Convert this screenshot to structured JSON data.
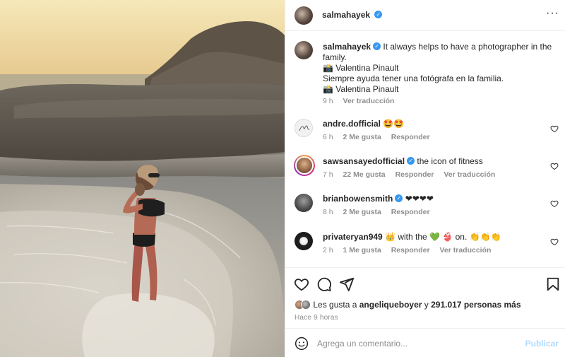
{
  "post": {
    "username": "salmahayek",
    "more_icon": "more-horizontal-icon",
    "caption": {
      "text": "It always helps to have a photographer in the family.",
      "credit": "📸 Valentina Pinault",
      "text_es": "Siempre ayuda tener una fotógrafa en la familia.",
      "credit_es": "📸 Valentina Pinault",
      "time": "9 h",
      "translate_label": "Ver traducción"
    }
  },
  "comments": [
    {
      "username": "andre.dofficial",
      "verified": false,
      "text": "🤩🤩",
      "time": "6 h",
      "likes": "2 Me gusta",
      "reply": "Responder",
      "translate": ""
    },
    {
      "username": "sawsansayedofficial",
      "verified": true,
      "text": "the icon of fitness",
      "time": "7 h",
      "likes": "22 Me gusta",
      "reply": "Responder",
      "translate": "Ver traducción"
    },
    {
      "username": "brianbowensmith",
      "verified": true,
      "text": "❤❤❤❤",
      "time": "8 h",
      "likes": "2 Me gusta",
      "reply": "Responder",
      "translate": ""
    },
    {
      "username": "privateryan949",
      "verified": false,
      "text": "👑 with the 💚 👙 on. 👏👏👏",
      "time": "2 h",
      "likes": "1 Me gusta",
      "reply": "Responder",
      "translate": "Ver traducción"
    }
  ],
  "likes_line": {
    "prefix": "Les gusta a",
    "user": "angeliqueboyer",
    "conj": "y",
    "count": "291.017 personas más"
  },
  "posted_ago": "Hace 9 horas",
  "add_comment": {
    "placeholder": "Agrega un comentario...",
    "post_label": "Publicar"
  },
  "colors": {
    "verified": "#3897f0",
    "muted": "#8e8e8e",
    "post_disabled": "#b3dbff"
  }
}
